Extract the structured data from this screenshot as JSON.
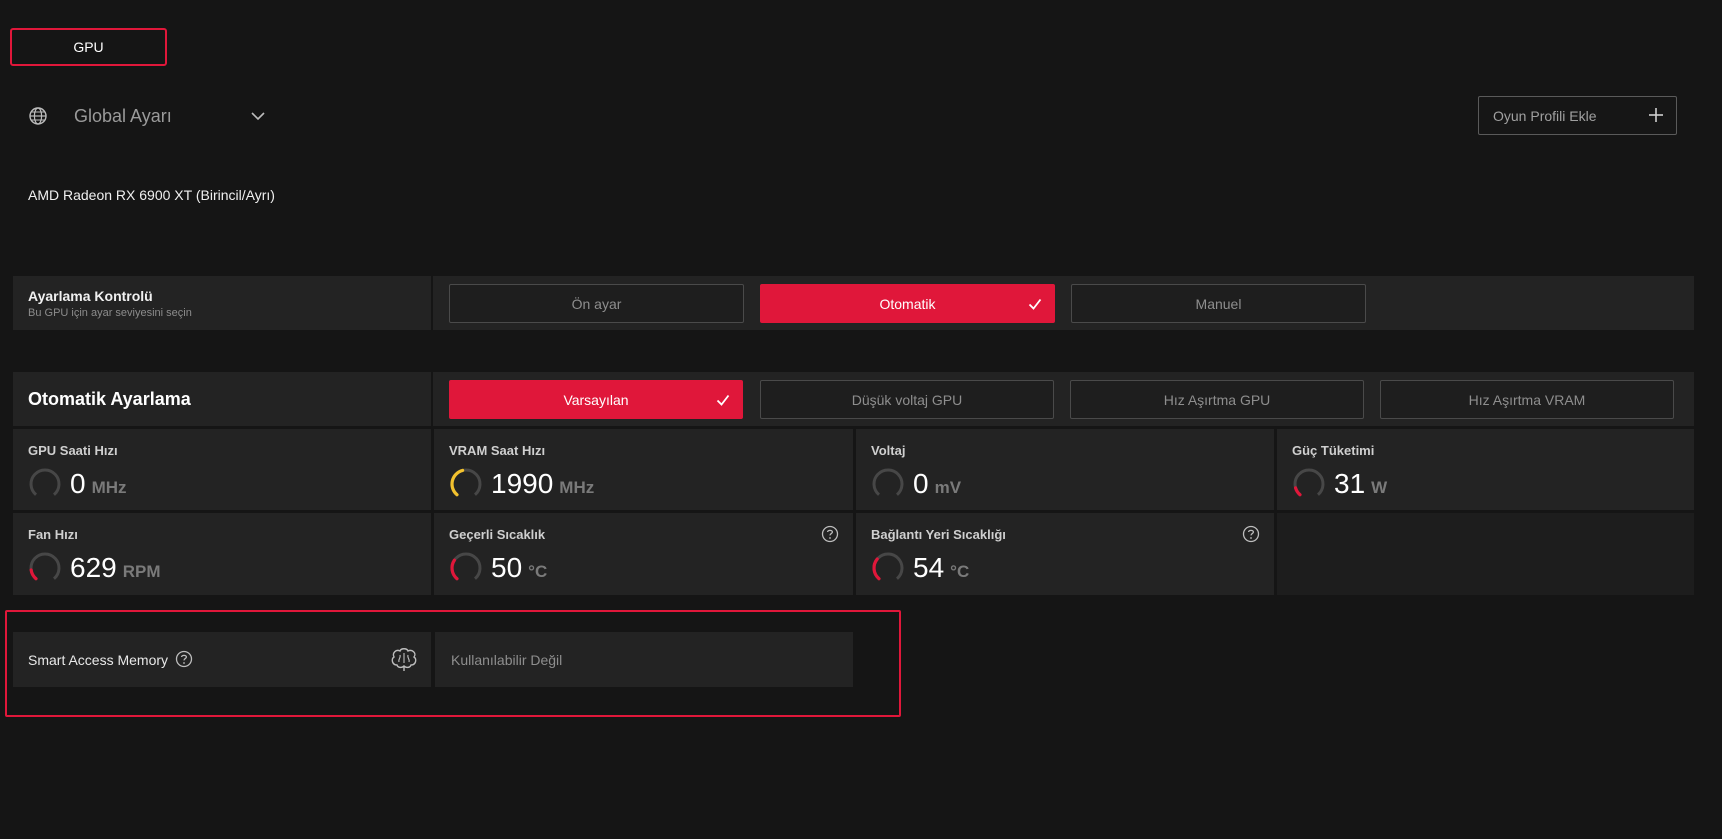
{
  "tab": {
    "label": "GPU"
  },
  "profile": {
    "name": "Global Ayarı",
    "add_label": "Oyun Profili Ekle"
  },
  "gpu_name": "AMD Radeon RX 6900 XT (Birincil/Ayrı)",
  "tuning_control": {
    "title": "Ayarlama Kontrolü",
    "subtitle": "Bu GPU için ayar seviyesini seçin",
    "options": [
      "Ön ayar",
      "Otomatik",
      "Manuel"
    ],
    "selected": "Otomatik"
  },
  "auto_tuning": {
    "title": "Otomatik Ayarlama",
    "options": [
      "Varsayılan",
      "Düşük voltaj GPU",
      "Hız Aşırtma GPU",
      "Hız Aşırtma VRAM"
    ],
    "selected": "Varsayılan"
  },
  "metrics": [
    {
      "label": "GPU Saati Hızı",
      "value": "0",
      "unit": "MHz",
      "level": 0,
      "color": "#4a4a4a"
    },
    {
      "label": "VRAM Saat Hızı",
      "value": "1990",
      "unit": "MHz",
      "level": 0.45,
      "color": "#f2c12e"
    },
    {
      "label": "Voltaj",
      "value": "0",
      "unit": "mV",
      "level": 0,
      "color": "#4a4a4a"
    },
    {
      "label": "Güç Tüketimi",
      "value": "31",
      "unit": "W",
      "level": 0.12,
      "color": "#e0173a"
    },
    {
      "label": "Fan Hızı",
      "value": "629",
      "unit": "RPM",
      "level": 0.15,
      "color": "#e0173a"
    },
    {
      "label": "Geçerli Sıcaklık",
      "value": "50",
      "unit": "°C",
      "level": 0.3,
      "color": "#e0173a"
    },
    {
      "label": "Bağlantı Yeri Sıcaklığı",
      "value": "54",
      "unit": "°C",
      "level": 0.32,
      "color": "#e0173a"
    }
  ],
  "sam": {
    "label": "Smart Access Memory",
    "status": "Kullanılabilir Değil"
  },
  "colors": {
    "accent": "#e0173a",
    "background": "#151515",
    "panel": "#232323"
  }
}
